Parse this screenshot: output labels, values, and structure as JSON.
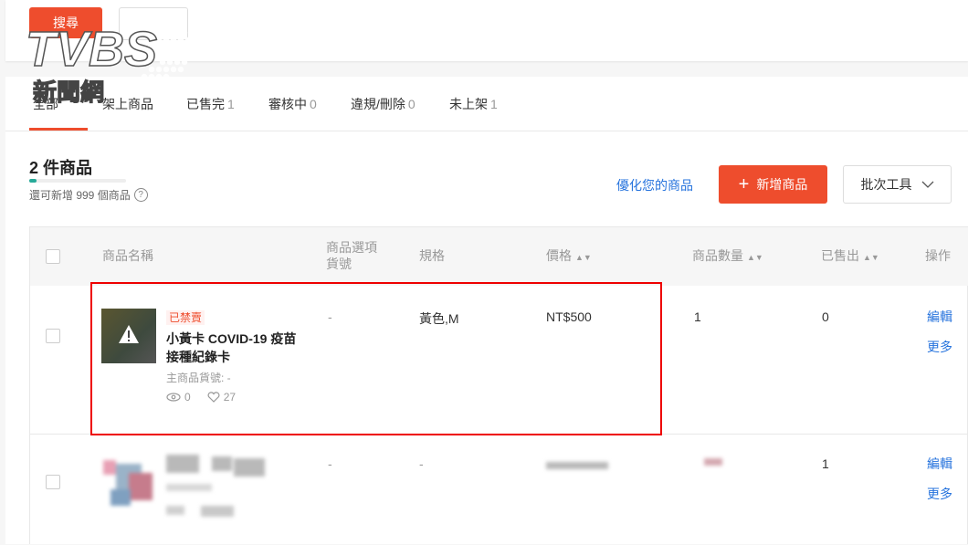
{
  "top_bar": {
    "search_label": "搜尋",
    "reset_label": ""
  },
  "logo": {
    "line1": "TVBS",
    "line2": "新聞網"
  },
  "tabs": [
    {
      "label": "全部",
      "count": ""
    },
    {
      "label": "架上商品",
      "count": ""
    },
    {
      "label": "已售完",
      "count": "1"
    },
    {
      "label": "審核中",
      "count": "0"
    },
    {
      "label": "違規/刪除",
      "count": "0"
    },
    {
      "label": "未上架",
      "count": "1"
    }
  ],
  "summary": {
    "title": "2 件商品",
    "quota_text": "還可新增 999 個商品",
    "quota_fill_fraction": 0.08,
    "help_icon": "?"
  },
  "actions": {
    "optimize_link": "優化您的商品",
    "add_button": "新增商品",
    "add_icon": "+",
    "batch_button": "批次工具",
    "batch_icon": "chevron-down-icon"
  },
  "table": {
    "headers": {
      "name": "商品名稱",
      "option_sku_line1": "商品選項",
      "option_sku_line2": "貨號",
      "spec": "規格",
      "price": "價格",
      "stock": "商品數量",
      "sold": "已售出",
      "ops": "操作"
    },
    "rows": [
      {
        "tag": "已禁賣",
        "name": "小黃卡 COVID-19 疫苗接種紀錄卡",
        "parent_sku": "主商品貨號: -",
        "views": "0",
        "likes": "27",
        "option_sku": "-",
        "spec": "黃色,M",
        "price": "NT$500",
        "stock": "1",
        "sold": "0",
        "edit": "編輯",
        "more": "更多"
      },
      {
        "option_sku": "-",
        "spec": "-",
        "sold": "1",
        "edit": "編輯",
        "more": "更多"
      }
    ]
  },
  "colors": {
    "accent": "#ee4d2d",
    "link": "#2673dd",
    "highlight": "#e00000"
  }
}
